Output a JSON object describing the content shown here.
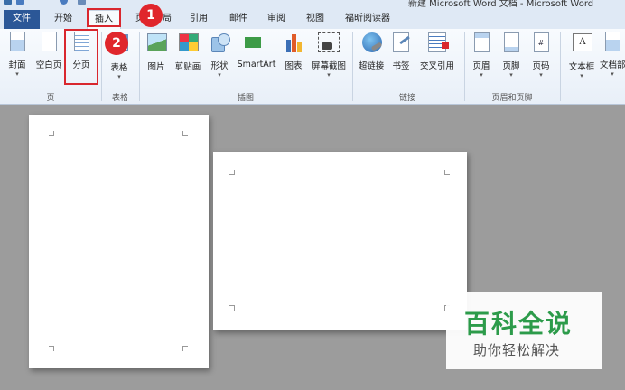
{
  "window": {
    "title": "新建 Microsoft Word 文档 - Microsoft Word"
  },
  "tabs": [
    {
      "label": "文件",
      "active": false
    },
    {
      "label": "开始",
      "active": false
    },
    {
      "label": "插入",
      "active": true
    },
    {
      "label": "页面布局",
      "active": false
    },
    {
      "label": "引用",
      "active": false
    },
    {
      "label": "邮件",
      "active": false
    },
    {
      "label": "审阅",
      "active": false
    },
    {
      "label": "视图",
      "active": false
    },
    {
      "label": "福昕阅读器",
      "active": false
    }
  ],
  "ribbon": {
    "groups": [
      {
        "label": "页",
        "buttons": [
          {
            "label": "封面",
            "icon": "cover-page-icon",
            "dropdown": true
          },
          {
            "label": "空白页",
            "icon": "blank-page-icon",
            "dropdown": false
          },
          {
            "label": "分页",
            "icon": "page-break-icon",
            "dropdown": false
          }
        ]
      },
      {
        "label": "表格",
        "buttons": [
          {
            "label": "表格",
            "icon": "table-icon",
            "dropdown": true
          }
        ]
      },
      {
        "label": "插图",
        "buttons": [
          {
            "label": "图片",
            "icon": "picture-icon",
            "dropdown": false
          },
          {
            "label": "剪贴画",
            "icon": "clip-art-icon",
            "dropdown": false
          },
          {
            "label": "形状",
            "icon": "shapes-icon",
            "dropdown": true
          },
          {
            "label": "SmartArt",
            "icon": "smartart-icon",
            "dropdown": false
          },
          {
            "label": "图表",
            "icon": "chart-icon",
            "dropdown": false
          },
          {
            "label": "屏幕截图",
            "icon": "screenshot-icon",
            "dropdown": true
          }
        ]
      },
      {
        "label": "链接",
        "buttons": [
          {
            "label": "超链接",
            "icon": "hyperlink-icon",
            "dropdown": false
          },
          {
            "label": "书签",
            "icon": "bookmark-icon",
            "dropdown": false
          },
          {
            "label": "交叉引用",
            "icon": "cross-reference-icon",
            "dropdown": false
          }
        ]
      },
      {
        "label": "页眉和页脚",
        "buttons": [
          {
            "label": "页眉",
            "icon": "header-icon",
            "dropdown": true
          },
          {
            "label": "页脚",
            "icon": "footer-icon",
            "dropdown": true
          },
          {
            "label": "页码",
            "icon": "page-number-icon",
            "dropdown": true,
            "glyph": "#"
          }
        ]
      },
      {
        "label": "",
        "buttons": [
          {
            "label": "文本框",
            "icon": "text-box-icon",
            "dropdown": true,
            "glyph": "A"
          },
          {
            "label": "文档部件",
            "icon": "quick-parts-icon",
            "dropdown": true
          }
        ]
      }
    ],
    "dropdown_glyph": "▾"
  },
  "annotations": {
    "step1": "1",
    "step2": "2",
    "highlight_color": "#d9272e"
  },
  "watermark": {
    "title": "百科全说",
    "subtitle": "助你轻松解决",
    "color": "#2c9b4a"
  }
}
